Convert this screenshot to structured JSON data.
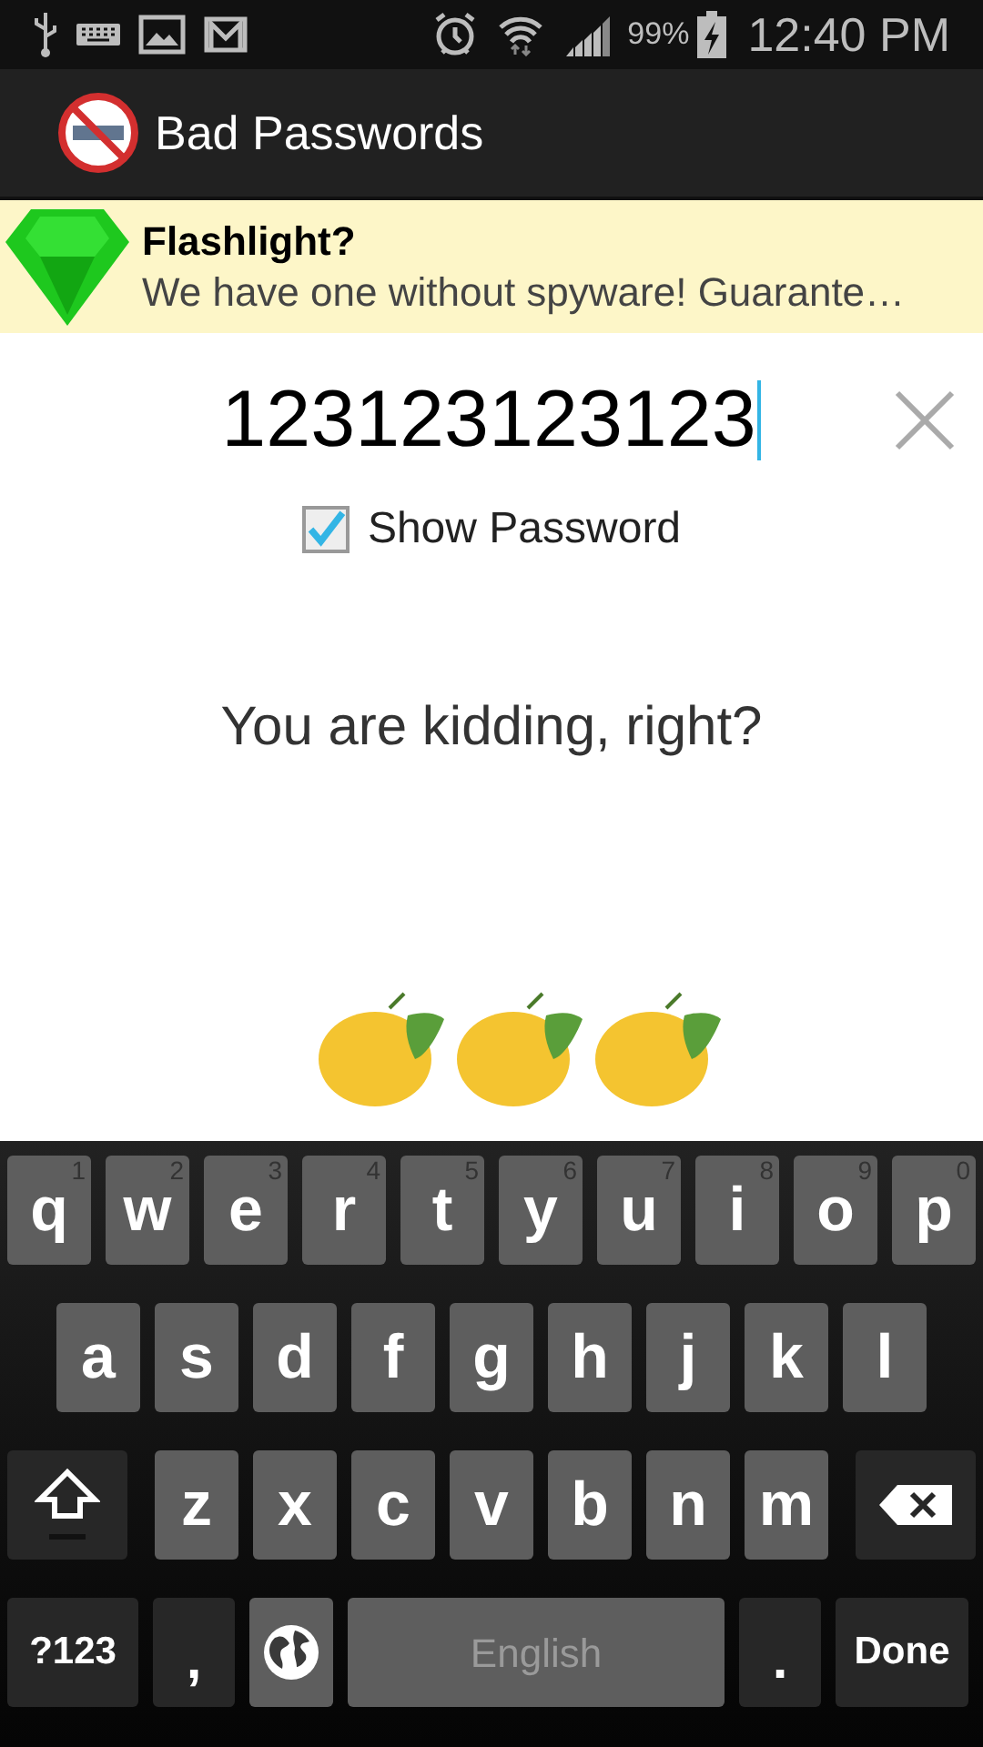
{
  "status_bar": {
    "battery": "99%",
    "time": "12:40 PM"
  },
  "app_bar": {
    "title": "Bad Passwords"
  },
  "ad": {
    "title": "Flashlight?",
    "text": "We have one without spyware! Guarante…"
  },
  "password_field": {
    "value": "123123123123"
  },
  "show_password": {
    "label": "Show Password",
    "checked": true
  },
  "message": "You are kidding, right?",
  "rating": {
    "stars": 3
  },
  "keyboard": {
    "rows": [
      [
        {
          "kind": "letter",
          "label": "q",
          "hint": "1"
        },
        {
          "kind": "letter",
          "label": "w",
          "hint": "2"
        },
        {
          "kind": "letter",
          "label": "e",
          "hint": "3"
        },
        {
          "kind": "letter",
          "label": "r",
          "hint": "4"
        },
        {
          "kind": "letter",
          "label": "t",
          "hint": "5"
        },
        {
          "kind": "letter",
          "label": "y",
          "hint": "6"
        },
        {
          "kind": "letter",
          "label": "u",
          "hint": "7"
        },
        {
          "kind": "letter",
          "label": "i",
          "hint": "8"
        },
        {
          "kind": "letter",
          "label": "o",
          "hint": "9"
        },
        {
          "kind": "letter",
          "label": "p",
          "hint": "0"
        }
      ],
      [
        {
          "kind": "letter",
          "label": "a"
        },
        {
          "kind": "letter",
          "label": "s"
        },
        {
          "kind": "letter",
          "label": "d"
        },
        {
          "kind": "letter",
          "label": "f"
        },
        {
          "kind": "letter",
          "label": "g"
        },
        {
          "kind": "letter",
          "label": "h"
        },
        {
          "kind": "letter",
          "label": "j"
        },
        {
          "kind": "letter",
          "label": "k"
        },
        {
          "kind": "letter",
          "label": "l"
        }
      ],
      [
        {
          "kind": "shift"
        },
        {
          "kind": "letter",
          "label": "z"
        },
        {
          "kind": "letter",
          "label": "x"
        },
        {
          "kind": "letter",
          "label": "c"
        },
        {
          "kind": "letter",
          "label": "v"
        },
        {
          "kind": "letter",
          "label": "b"
        },
        {
          "kind": "letter",
          "label": "n"
        },
        {
          "kind": "letter",
          "label": "m"
        },
        {
          "kind": "delete"
        }
      ]
    ],
    "bottom_row": {
      "symbols_key": "?123",
      "comma_key": ",",
      "space_key": "English",
      "period_key": ".",
      "done_key": "Done"
    }
  }
}
